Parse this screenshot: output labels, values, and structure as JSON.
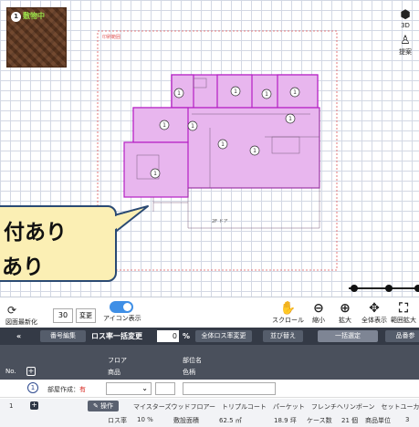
{
  "thumbnail": {
    "badge_num": "1",
    "badge_label": "敷物中"
  },
  "right_tools": [
    {
      "icon": "cube-icon",
      "label": "3D"
    },
    {
      "icon": "person-icon",
      "label": "提案"
    }
  ],
  "plan": {
    "print_range_label": "印刷範囲",
    "room_markers": [
      "1",
      "1",
      "1",
      "1",
      "1",
      "1",
      "1",
      "1",
      "1",
      "1"
    ],
    "dim_label": "2F ドア"
  },
  "callout": {
    "line1": "付あり",
    "line2": "あり"
  },
  "toolbar": {
    "refresh_label": "図面最新化",
    "page_value": "30",
    "change_label": "変更",
    "icon_toggle_label": "アイコン表示",
    "tools": [
      {
        "name": "scroll",
        "icon": "hand-icon",
        "glyph": "✋",
        "label": "スクロール"
      },
      {
        "name": "shrink",
        "icon": "zoom-out-icon",
        "glyph": "🔍",
        "label": "縮小"
      },
      {
        "name": "expand",
        "icon": "zoom-in-icon",
        "glyph": "🔍",
        "label": "拡大"
      },
      {
        "name": "fit-all",
        "icon": "move-icon",
        "glyph": "✥",
        "label": "全体表示"
      },
      {
        "name": "range-expand",
        "icon": "range-expand-icon",
        "glyph": "⛶",
        "label": "範囲拡大"
      }
    ]
  },
  "darkbar": {
    "back_label": "«",
    "number_edit_label": "番号編集",
    "loss_bulk_label": "ロス率一括変更",
    "loss_value": "0",
    "percent": "%",
    "all_loss_label": "全体ロス率変更",
    "sort_label": "並び替え",
    "bulk_set_label": "一括選定",
    "product_label": "品番参"
  },
  "table": {
    "headers": {
      "no": "No.",
      "floor": "フロア",
      "product": "商品",
      "room": "部位名",
      "color": "色柄"
    },
    "row_create": {
      "num": "1",
      "label_prefix": "部屋作成：",
      "label_value": "有"
    },
    "row_item": {
      "no": "1",
      "op_label": "操作",
      "desc": "マイスターズウッドフロアー　トリプルコート　パーケット　フレンチヘリンボーン　セットユーカ"
    },
    "row_detail": {
      "loss_label": "ロス率",
      "loss_value": "10 %",
      "area_label": "敷設面積",
      "area_value": "62.5 ㎡",
      "tsubo": "18.9 坪",
      "case_label": "ケース数",
      "case_value": "21 個",
      "unit_label": "商品単位",
      "unit_value": "3"
    }
  },
  "colors": {
    "accent": "#3f8fe6",
    "room_fill": "#e8b6ee",
    "room_stroke": "#b51ec4",
    "dark": "#343a46"
  }
}
